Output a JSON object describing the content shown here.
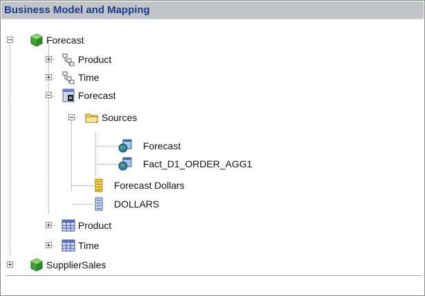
{
  "panel": {
    "title": "Business Model and Mapping"
  },
  "tree": {
    "nodes": [
      {
        "label": "Forecast",
        "icon": "cube-icon"
      },
      {
        "label": "Product",
        "icon": "hierarchy-icon"
      },
      {
        "label": "Time",
        "icon": "hierarchy-icon"
      },
      {
        "label": "Forecast",
        "icon": "fact-table-icon"
      },
      {
        "label": "Sources",
        "icon": "folder-icon"
      },
      {
        "label": "Forecast",
        "icon": "logical-source-icon"
      },
      {
        "label": "Fact_D1_ORDER_AGG1",
        "icon": "logical-source-icon"
      },
      {
        "label": "Forecast Dollars",
        "icon": "measure-column-icon"
      },
      {
        "label": "DOLLARS",
        "icon": "column-icon"
      },
      {
        "label": "Product",
        "icon": "dimension-table-icon"
      },
      {
        "label": "Time",
        "icon": "dimension-table-icon"
      },
      {
        "label": "SupplierSales",
        "icon": "cube-icon"
      }
    ]
  },
  "colors": {
    "title_text": "#1c3a8a",
    "title_bg": "#c0c4c8"
  }
}
